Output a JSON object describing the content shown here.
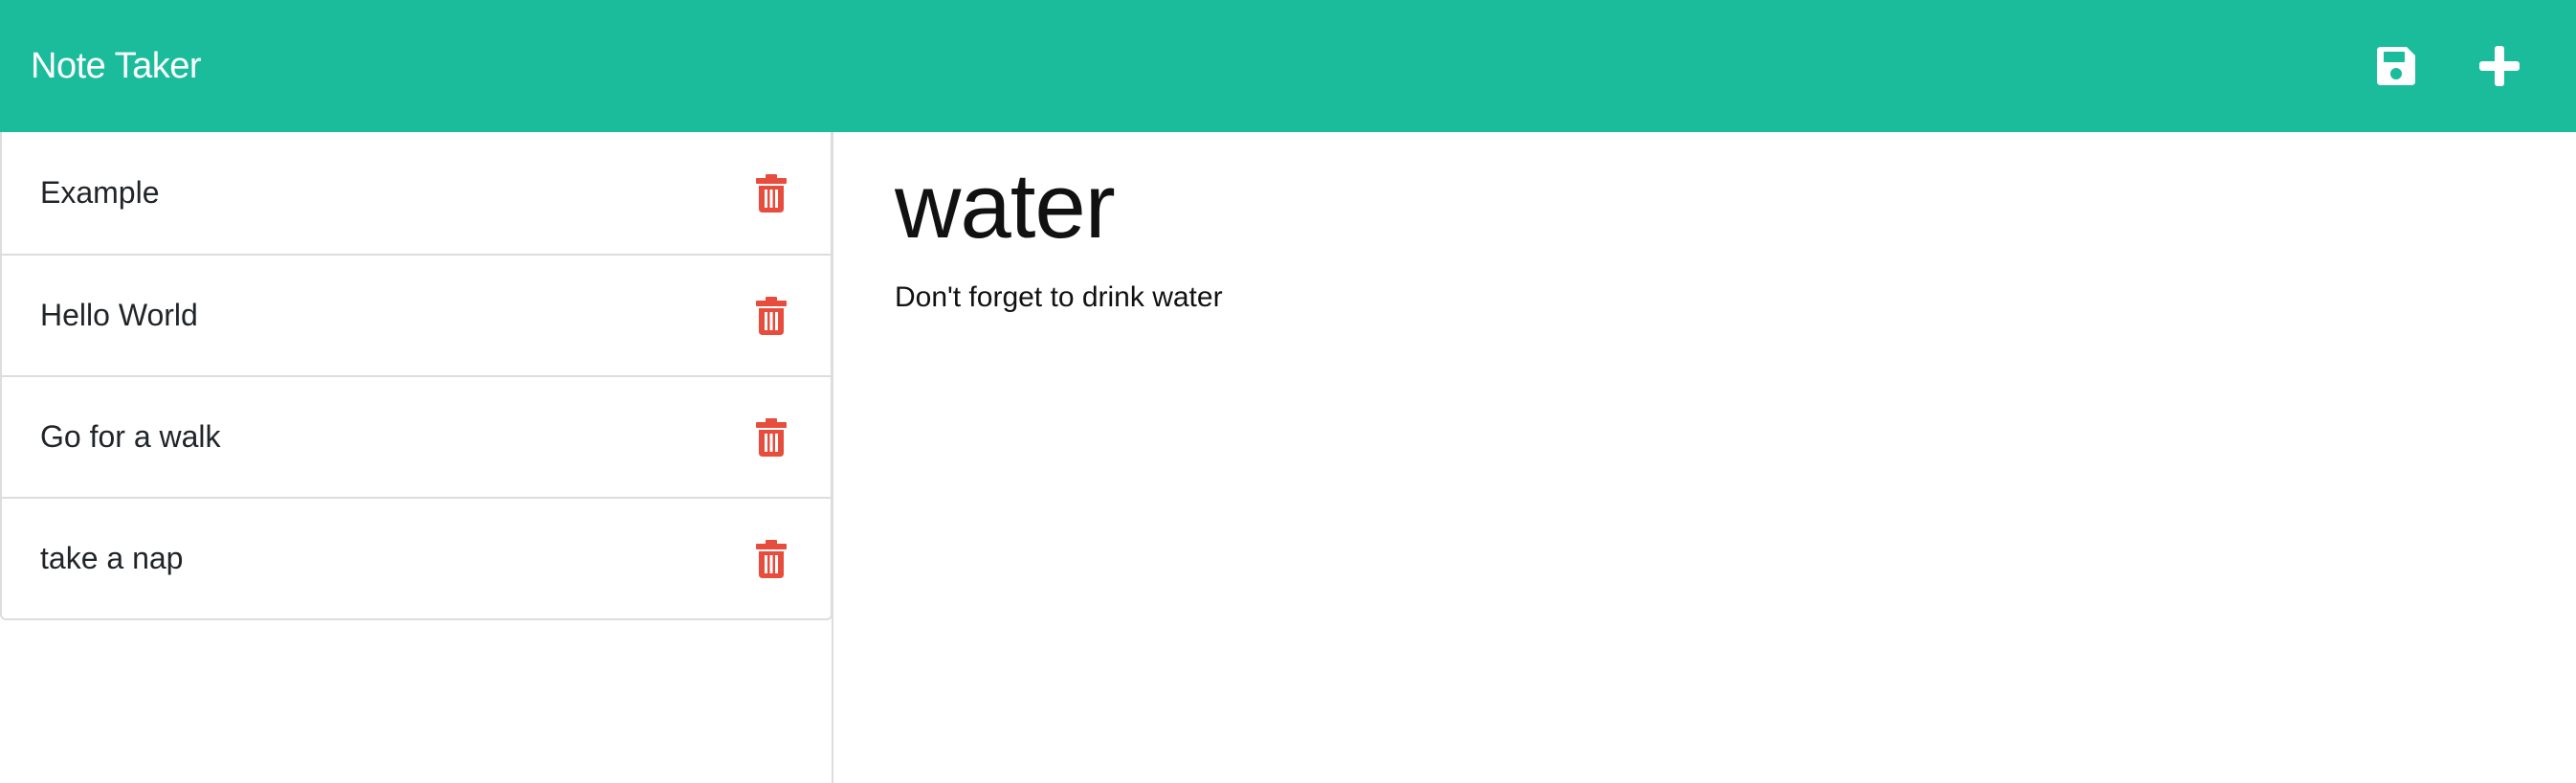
{
  "app": {
    "title": "Note Taker"
  },
  "toolbar": {
    "save_icon": "floppy-disk-icon",
    "new_icon": "plus-icon"
  },
  "notes": [
    {
      "title": "Example"
    },
    {
      "title": "Hello World"
    },
    {
      "title": "Go for a walk"
    },
    {
      "title": "take a nap"
    }
  ],
  "active_note": {
    "title": "water",
    "text": "Don't forget to drink water"
  },
  "colors": {
    "brand": "#1abc9c",
    "delete": "#e74c3c"
  }
}
